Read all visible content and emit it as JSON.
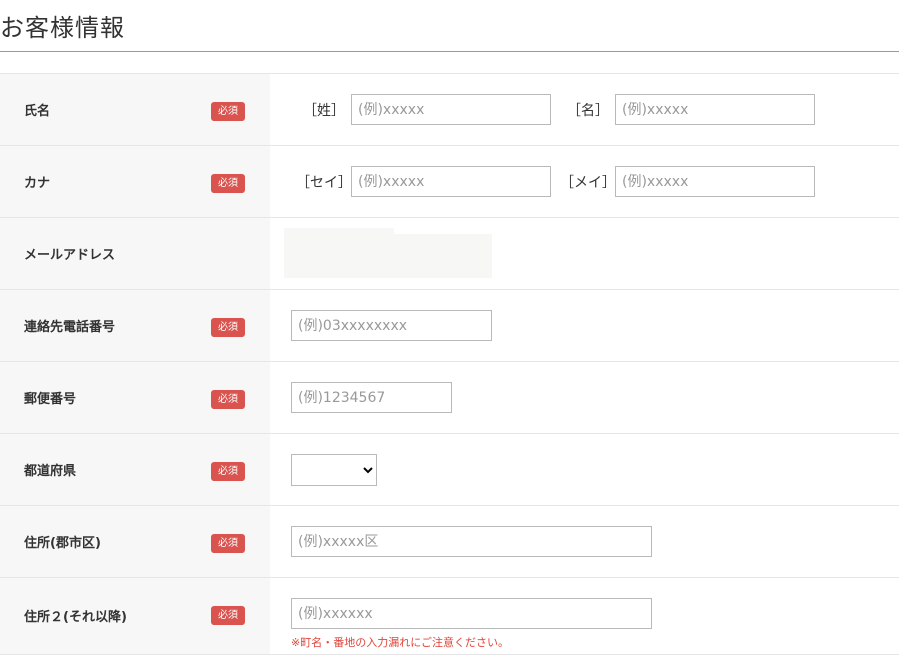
{
  "page": {
    "title": "お客様情報"
  },
  "form": {
    "required_label": "必須",
    "rows": {
      "name": {
        "label": "氏名",
        "last_prefix": "［姓］",
        "last_placeholder": "(例)xxxxx",
        "first_prefix": "［名］",
        "first_placeholder": "(例)xxxxx"
      },
      "kana": {
        "label": "カナ",
        "last_prefix": "［セイ］",
        "last_placeholder": "(例)xxxxx",
        "first_prefix": "［メイ］",
        "first_placeholder": "(例)xxxxx"
      },
      "email": {
        "label": "メールアドレス"
      },
      "phone": {
        "label": "連絡先電話番号",
        "placeholder": "(例)03xxxxxxxx"
      },
      "postal": {
        "label": "郵便番号",
        "placeholder": "(例)1234567"
      },
      "prefecture": {
        "label": "都道府県",
        "selected": ""
      },
      "address1": {
        "label": "住所(郡市区)",
        "placeholder": "(例)xxxxx区"
      },
      "address2": {
        "label": "住所２(それ以降)",
        "placeholder": "(例)xxxxxx",
        "note": "※町名・番地の入力漏れにご注意ください。"
      }
    }
  },
  "colors": {
    "badge": "#d9534f",
    "label_bg": "#f7f7f7",
    "note": "#e0453a",
    "border": "#b9b9b9"
  }
}
